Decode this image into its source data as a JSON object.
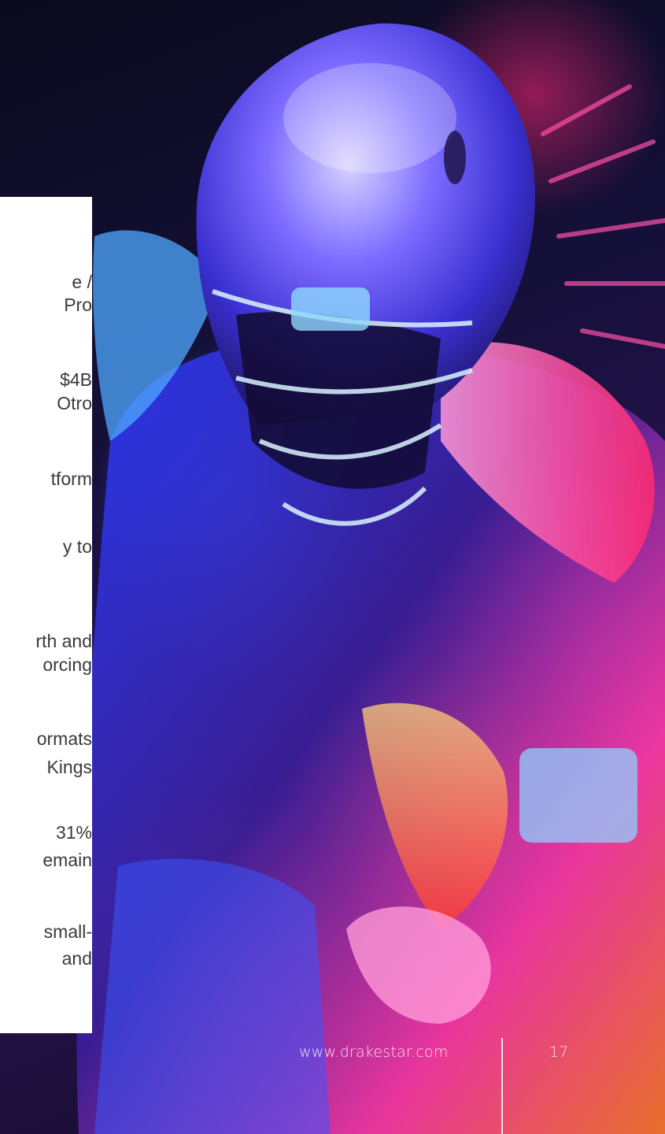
{
  "panel": {
    "lines": [
      "e /",
      "Pro",
      "$4B",
      "Otro",
      "tform",
      "y to",
      "rth and",
      "orcing",
      "ormats",
      "Kings",
      "31%",
      "emain",
      "small-",
      "and"
    ]
  },
  "footer": {
    "url": "www.drakestar.com",
    "page_number": "17"
  },
  "colors": {
    "panel_bg": "#ffffff",
    "panel_text": "#3a3a3a",
    "footer_text": "#ffffff"
  }
}
